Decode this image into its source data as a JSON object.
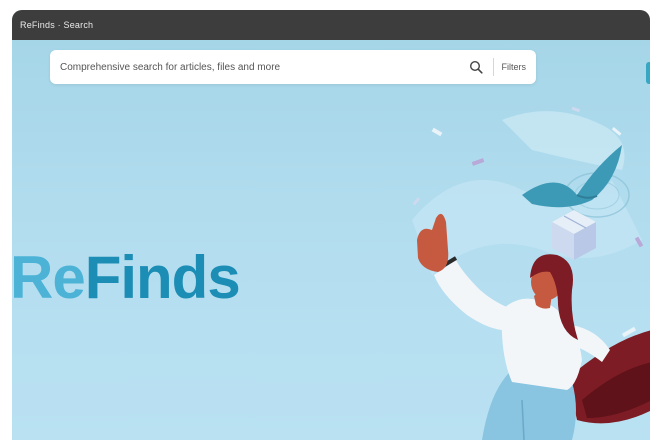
{
  "window": {
    "title": "ReFinds · Search"
  },
  "search": {
    "placeholder": "Comprehensive search for articles, files and more"
  },
  "search_button_label": "Filters",
  "brand": {
    "part1": "Re",
    "part2": "Finds"
  },
  "colors": {
    "titlebar": "#3d3d3d",
    "background": "#a8d8ea",
    "brand_light": "#4cb3d6",
    "brand_dark": "#1c8db4",
    "cape": "#7d1c24"
  },
  "icons": [
    "search-icon",
    "hero-illustration"
  ]
}
